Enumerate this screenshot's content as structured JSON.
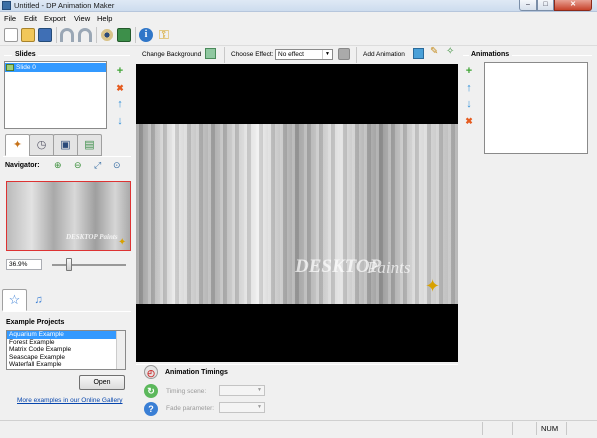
{
  "window": {
    "title": "Untitled - DP Animation Maker",
    "minimize": "–",
    "maximize": "□",
    "close": "✕"
  },
  "menu": [
    "File",
    "Edit",
    "Export",
    "View",
    "Help"
  ],
  "toolbar_icons": [
    "new-icon",
    "open-icon",
    "save-icon",
    "undo-icon",
    "redo-icon",
    "preview-icon",
    "export-icon",
    "info-icon",
    "key-icon"
  ],
  "slides": {
    "title": "Slides",
    "items": [
      "Slide 0"
    ],
    "add": "+",
    "remove": "✖",
    "up": "↑",
    "down": "↓"
  },
  "left_tabs": [
    "properties-icon",
    "timer-icon",
    "camera-icon",
    "add-image-icon"
  ],
  "navigator": {
    "title": "Navigator:",
    "zoom": "36.9%",
    "watermark": "DESKTOP Paints"
  },
  "bottom_tabs": [
    "star-icon",
    "music-icon"
  ],
  "examples": {
    "title": "Example Projects",
    "items": [
      "Aquarium Example",
      "Forest Example",
      "Matrix Code Example",
      "Seascape Example",
      "Waterfall Example"
    ],
    "selected": 0,
    "open_label": "Open",
    "gallery_link": "More examples in our Online Gallery"
  },
  "center_toolbar": {
    "change_background": "Change Background",
    "choose_effect": "Choose Effect:",
    "effect_value": "No effect",
    "add_animation": "Add Animation"
  },
  "canvas": {
    "watermark_a": "DESKTOP",
    "watermark_b": "Paints"
  },
  "timings": {
    "title": "Animation Timings",
    "timing_scene": "Timing scene:",
    "fade_parameter": "Fade parameter:"
  },
  "animations": {
    "title": "Animations",
    "add": "+",
    "up": "↑",
    "down": "↓",
    "remove": "✖"
  },
  "status": {
    "num": "NUM"
  }
}
